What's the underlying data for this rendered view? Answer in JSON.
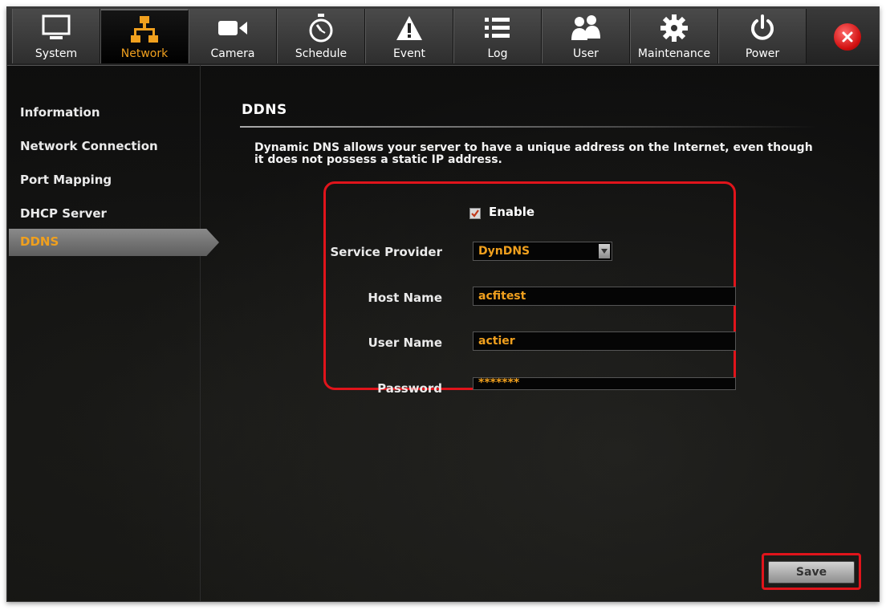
{
  "tabs": [
    {
      "label": "System",
      "icon": "monitor-icon"
    },
    {
      "label": "Network",
      "icon": "network-icon",
      "active": true
    },
    {
      "label": "Camera",
      "icon": "camera-icon"
    },
    {
      "label": "Schedule",
      "icon": "stopwatch-icon"
    },
    {
      "label": "Event",
      "icon": "warning-icon"
    },
    {
      "label": "Log",
      "icon": "list-icon"
    },
    {
      "label": "User",
      "icon": "users-icon"
    },
    {
      "label": "Maintenance",
      "icon": "gear-icon"
    },
    {
      "label": "Power",
      "icon": "power-icon"
    }
  ],
  "sidebar": {
    "items": [
      {
        "label": "Information"
      },
      {
        "label": "Network Connection"
      },
      {
        "label": "Port Mapping"
      },
      {
        "label": "DHCP Server"
      },
      {
        "label": "DDNS",
        "active": true
      }
    ]
  },
  "main": {
    "title": "DDNS",
    "description": "Dynamic DNS allows your server to have a unique address on the Internet, even though it does not possess a static IP address.",
    "enable_label": "Enable",
    "enable_checked": true,
    "service_provider": {
      "label": "Service Provider",
      "value": "DynDNS"
    },
    "host_name": {
      "label": "Host Name",
      "value": "acfitest"
    },
    "user_name": {
      "label": "User Name",
      "value": "actier"
    },
    "password": {
      "label": "Password",
      "value": "*******"
    },
    "save_label": "Save"
  },
  "colors": {
    "accent": "#f0a01e",
    "highlight": "#e0141b",
    "background": "#0b0b0b"
  }
}
